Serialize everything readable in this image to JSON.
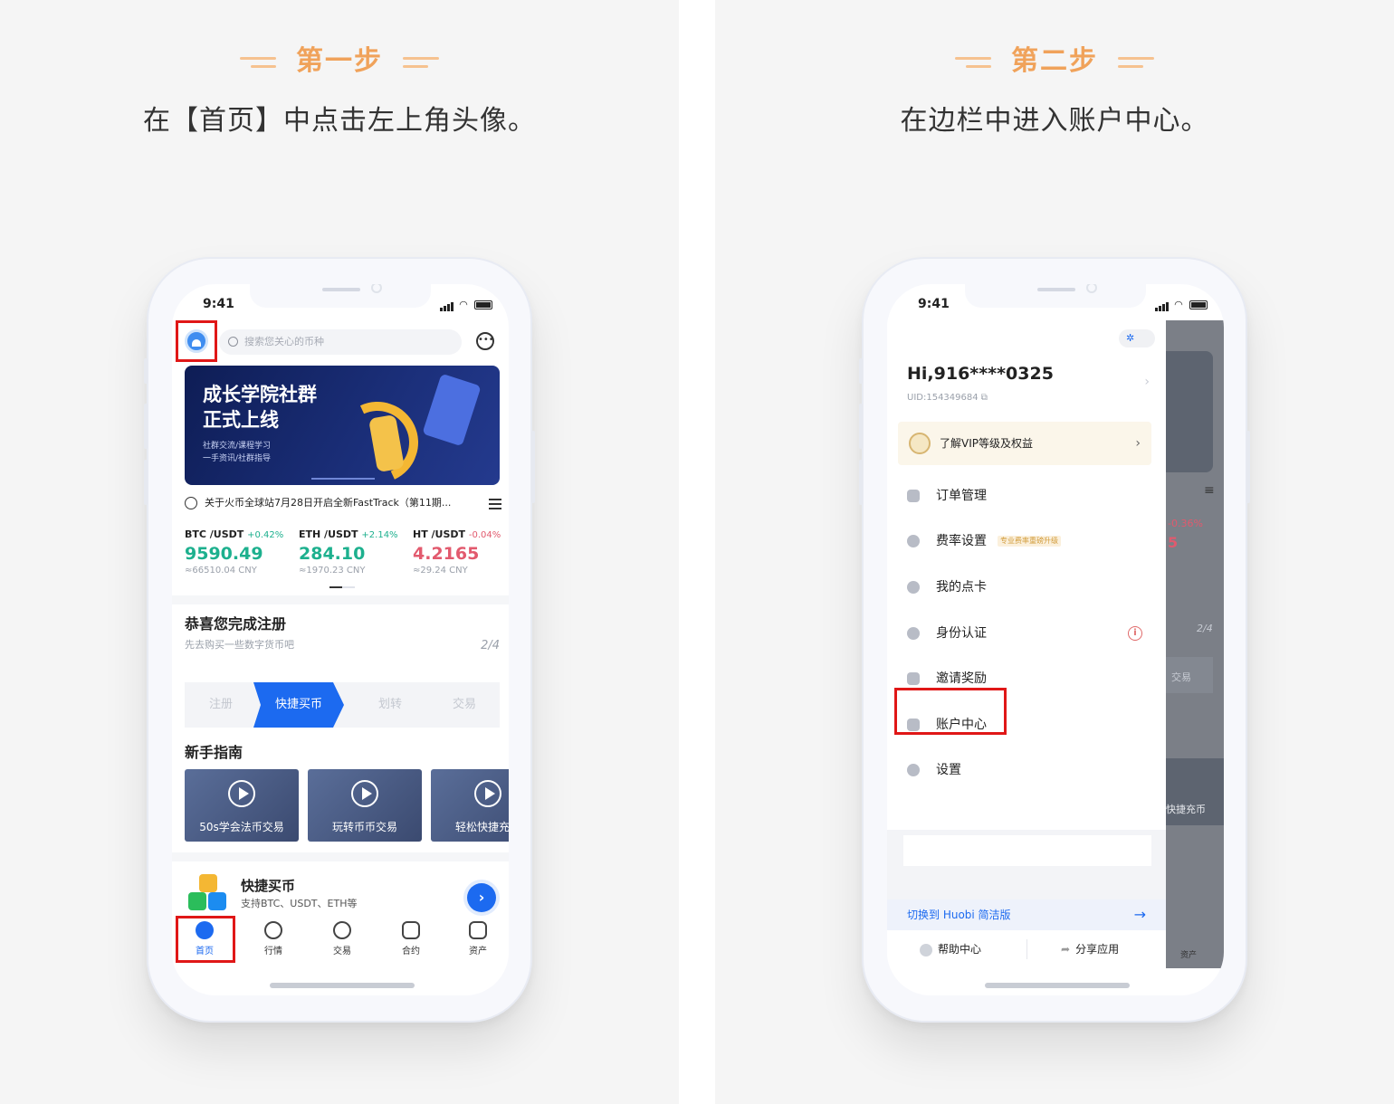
{
  "left": {
    "step_title": "第一步",
    "instruction": "在【首页】中点击左上角头像。",
    "status_time": "9:41",
    "search_placeholder": "搜索您关心的币种",
    "banner": {
      "title_line1": "成长学院社群",
      "title_line2": "正式上线",
      "sub_line1": "社群交流/课程学习",
      "sub_line2": "一手资讯/社群指导"
    },
    "notice": "关于火币全球站7月28日开启全新FastTrack（第11期...",
    "tickers": [
      {
        "pair": "BTC /USDT",
        "change": "+0.42%",
        "price": "9590.49",
        "cny": "≈66510.04 CNY",
        "trend": "up"
      },
      {
        "pair": "ETH /USDT",
        "change": "+2.14%",
        "price": "284.10",
        "cny": "≈1970.23 CNY",
        "trend": "up"
      },
      {
        "pair": "HT /USDT",
        "change": "-0.04%",
        "price": "4.2165",
        "cny": "≈29.24 CNY",
        "trend": "down"
      }
    ],
    "register": {
      "title": "恭喜您完成注册",
      "subtitle": "先去购买一些数字货币吧",
      "progress": "2/4",
      "steps": [
        "注册",
        "快捷买币",
        "划转",
        "交易"
      ]
    },
    "guide_title": "新手指南",
    "videos": [
      "50s学会法币交易",
      "玩转币币交易",
      "轻松快捷充币"
    ],
    "quick_buy": {
      "title": "快捷买币",
      "subtitle": "支持BTC、USDT、ETH等"
    },
    "tabs": [
      "首页",
      "行情",
      "交易",
      "合约",
      "资产"
    ]
  },
  "right": {
    "step_title": "第二步",
    "instruction": "在边栏中进入账户中心。",
    "status_time": "9:41",
    "greeting": "Hi,916****0325",
    "uid": "UID:154349684",
    "vip_label": "了解VIP等级及权益",
    "menu": [
      {
        "label": "订单管理"
      },
      {
        "label": "费率设置",
        "tag": "专业费率重磅升级"
      },
      {
        "label": "我的点卡"
      },
      {
        "label": "身份认证",
        "info": "i"
      },
      {
        "label": "邀请奖励"
      },
      {
        "label": "账户中心"
      },
      {
        "label": "设置"
      }
    ],
    "switch_label": "切换到 Huobi 简洁版",
    "help_label": "帮助中心",
    "share_label": "分享应用",
    "behind": {
      "change": "-0.36%",
      "digit": "5",
      "progress": "2/4",
      "trade": "交易",
      "quick": "快捷充币",
      "asset": "资产"
    }
  }
}
